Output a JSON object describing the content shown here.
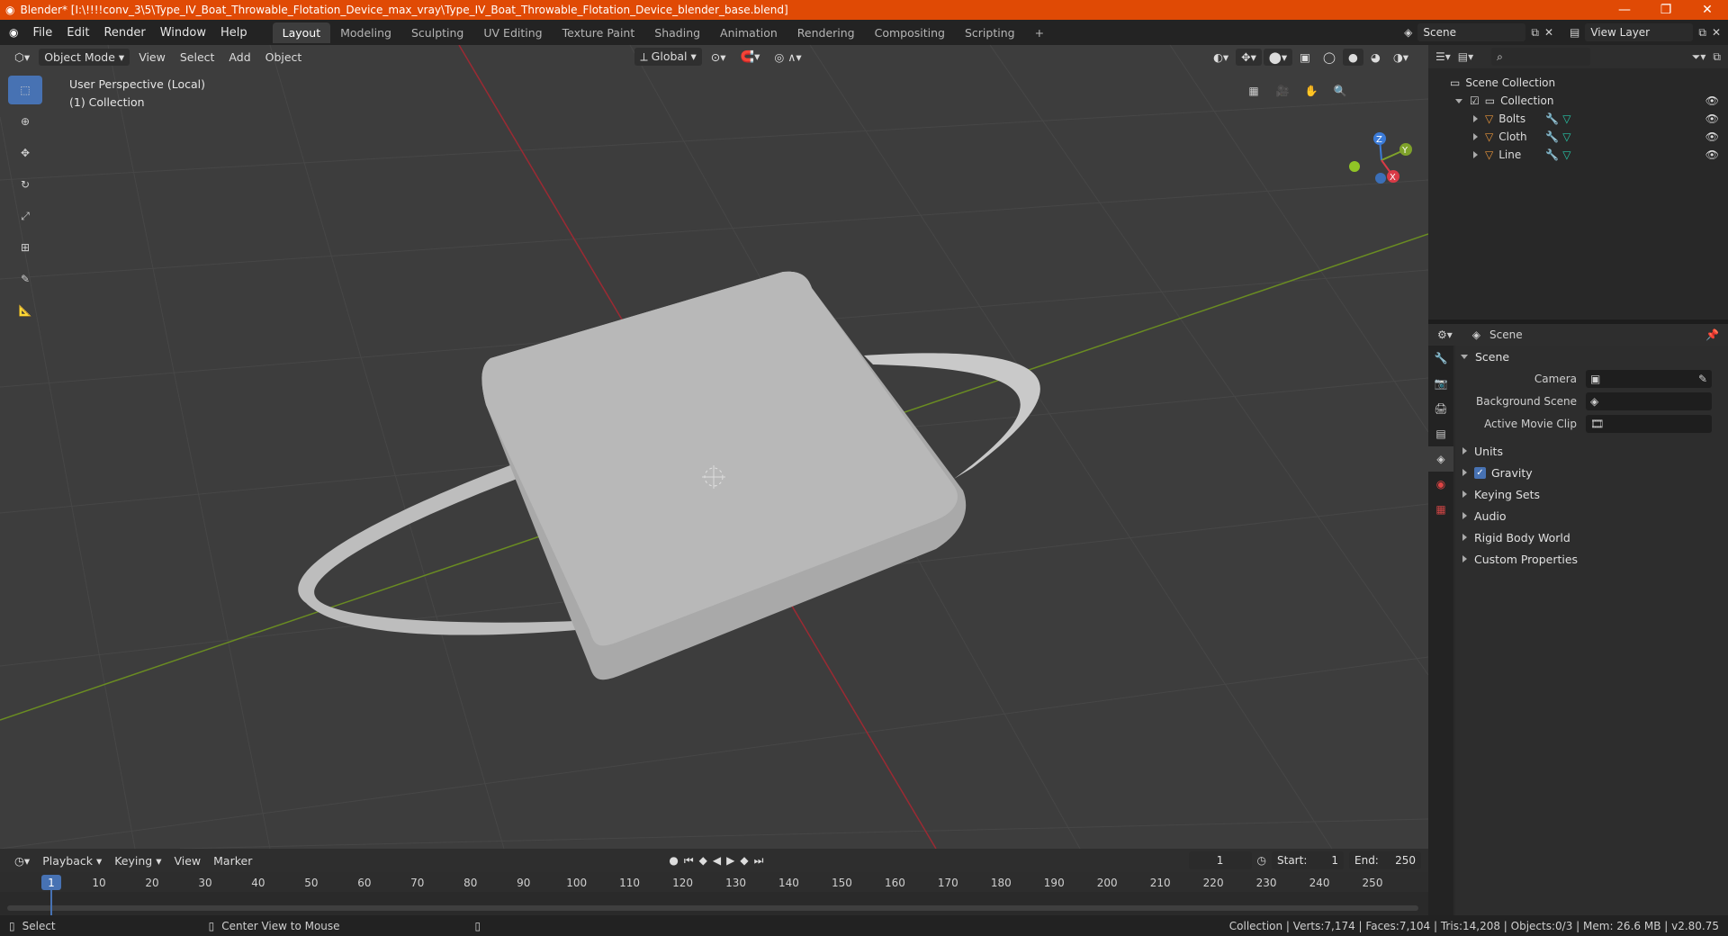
{
  "title": "Blender* [I:\\!!!!conv_3\\5\\Type_IV_Boat_Throwable_Flotation_Device_max_vray\\Type_IV_Boat_Throwable_Flotation_Device_blender_base.blend]",
  "menu": [
    "File",
    "Edit",
    "Render",
    "Window",
    "Help"
  ],
  "workspaces": [
    "Layout",
    "Modeling",
    "Sculpting",
    "UV Editing",
    "Texture Paint",
    "Shading",
    "Animation",
    "Rendering",
    "Compositing",
    "Scripting"
  ],
  "add_workspace": "+",
  "scene_field": "Scene",
  "viewlayer_field": "View Layer",
  "viewport_header": {
    "mode": "Object Mode",
    "view": "View",
    "select": "Select",
    "add": "Add",
    "object": "Object",
    "orientation": "Global"
  },
  "overlay": {
    "line1": "User Perspective (Local)",
    "line2": "(1) Collection"
  },
  "gizmo": {
    "x": "X",
    "y": "Y",
    "z": "Z"
  },
  "outliner": {
    "scene_collection": "Scene Collection",
    "collection": "Collection",
    "items": [
      "Bolts",
      "Cloth",
      "Line"
    ]
  },
  "properties": {
    "header": "Scene",
    "panel": "Scene",
    "camera_label": "Camera",
    "background_label": "Background Scene",
    "movieclip_label": "Active Movie Clip",
    "subpanels": [
      "Units",
      "Gravity",
      "Keying Sets",
      "Audio",
      "Rigid Body World",
      "Custom Properties"
    ]
  },
  "timeline": {
    "playback": "Playback",
    "keying": "Keying",
    "view": "View",
    "marker": "Marker",
    "current_frame": "1",
    "start_label": "Start:",
    "start_value": "1",
    "end_label": "End:",
    "end_value": "250",
    "ticks": [
      "1",
      "10",
      "20",
      "30",
      "40",
      "50",
      "60",
      "70",
      "80",
      "90",
      "100",
      "110",
      "120",
      "130",
      "140",
      "150",
      "160",
      "170",
      "180",
      "190",
      "200",
      "210",
      "220",
      "230",
      "240",
      "250"
    ]
  },
  "status": {
    "select": "Select",
    "center": "Center View to Mouse",
    "stats": "Collection | Verts:7,174 | Faces:7,104 | Tris:14,208 | Objects:0/3 | Mem: 26.6 MB | v2.80.75"
  },
  "colors": {
    "titlebar": "#e04a05",
    "accent": "#4772b3",
    "viewport": "#3d3d3d"
  }
}
